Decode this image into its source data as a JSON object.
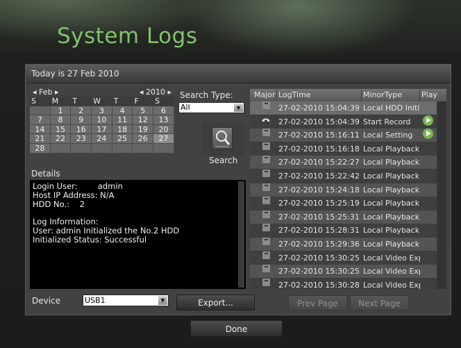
{
  "window": {
    "title": "System Logs",
    "today": "Today is 27 Feb 2010"
  },
  "calendar": {
    "month": "Feb",
    "year": "2010",
    "weekdays": [
      "S",
      "M",
      "T",
      "W",
      "T",
      "F",
      "S"
    ],
    "weeks": [
      [
        "",
        "1",
        "2",
        "3",
        "4",
        "5",
        "6"
      ],
      [
        "7",
        "8",
        "9",
        "10",
        "11",
        "12",
        "13"
      ],
      [
        "14",
        "15",
        "16",
        "17",
        "18",
        "19",
        "20"
      ],
      [
        "21",
        "22",
        "23",
        "24",
        "25",
        "26",
        "27"
      ],
      [
        "28",
        "",
        "",
        "",
        "",
        "",
        ""
      ]
    ],
    "selected": "27"
  },
  "search": {
    "type_label": "Search Type:",
    "type_value": "All",
    "button_label": "Search"
  },
  "details": {
    "label": "Details",
    "lines": [
      "Login User:        admin",
      "Host IP Address: N/A",
      "HDD No.:    2",
      "",
      "Log Information:",
      "User: admin Initialized the No.2 HDD",
      "Initialized Status: Successful"
    ]
  },
  "log_table": {
    "columns": [
      "Major",
      "LogTime",
      "MinorType",
      "Play"
    ],
    "rows": [
      {
        "icon": "table-icon",
        "time": "27-02-2010 15:04:39",
        "minor": "Local HDD Initia",
        "play": false
      },
      {
        "icon": "eye-icon",
        "time": "27-02-2010 15:04:39",
        "minor": "Start Record",
        "play": true
      },
      {
        "icon": "table-icon",
        "time": "27-02-2010 15:16:11",
        "minor": "Local Setting",
        "play": true
      },
      {
        "icon": "table-icon",
        "time": "27-02-2010 15:16:18",
        "minor": "Local Playback",
        "play": false
      },
      {
        "icon": "table-icon",
        "time": "27-02-2010 15:22:27",
        "minor": "Local Playback",
        "play": false
      },
      {
        "icon": "table-icon",
        "time": "27-02-2010 15:22:42",
        "minor": "Local Playback",
        "play": false
      },
      {
        "icon": "table-icon",
        "time": "27-02-2010 15:24:18",
        "minor": "Local Playback",
        "play": false
      },
      {
        "icon": "table-icon",
        "time": "27-02-2010 15:25:19",
        "minor": "Local Playback",
        "play": false
      },
      {
        "icon": "table-icon",
        "time": "27-02-2010 15:25:31",
        "minor": "Local Playback",
        "play": false
      },
      {
        "icon": "table-icon",
        "time": "27-02-2010 15:28:31",
        "minor": "Local Playback",
        "play": false
      },
      {
        "icon": "table-icon",
        "time": "27-02-2010 15:29:36",
        "minor": "Local Playback",
        "play": false
      },
      {
        "icon": "table-icon",
        "time": "27-02-2010 15:30:25",
        "minor": "Local Video Exp",
        "play": false
      },
      {
        "icon": "table-icon",
        "time": "27-02-2010 15:30:25",
        "minor": "Local Video Exp",
        "play": false
      },
      {
        "icon": "table-icon",
        "time": "27-02-2010 15:30:28",
        "minor": "Local Video Exp",
        "play": false
      }
    ]
  },
  "device": {
    "label": "Device",
    "value": "USB1"
  },
  "buttons": {
    "export": "Export...",
    "prev_page": "Prev Page",
    "next_page": "Next Page",
    "done": "Done"
  },
  "colors": {
    "title_green": "#7fc36a",
    "play_green": "#78b948",
    "row_dark": "#3f3f3f",
    "row_light": "#545454",
    "row_highlight": "#6d6d6d"
  }
}
